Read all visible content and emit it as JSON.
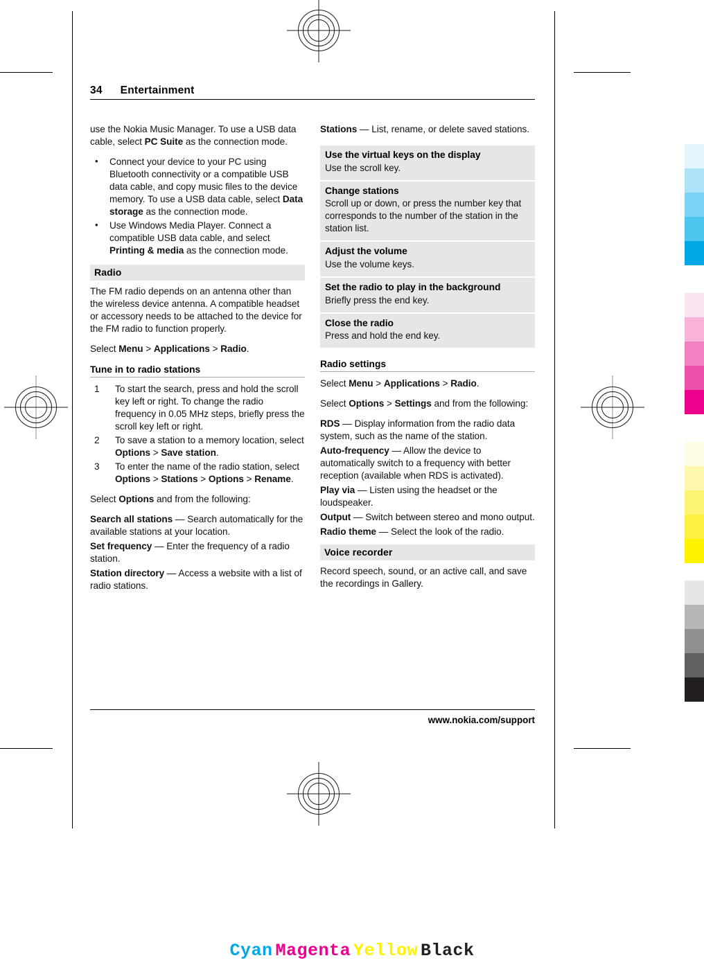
{
  "document": {
    "page_number": "34",
    "chapter": "Entertainment",
    "footer_url": "www.nokia.com/support"
  },
  "left_column": {
    "continued_paragraph": {
      "text_1": "use the Nokia Music Manager. To use a USB data cable, select ",
      "bold_1": "PC Suite",
      "text_2": " as the connection mode."
    },
    "bullets": [
      {
        "text_1": "Connect your device to your PC using Bluetooth connectivity or a compatible USB data cable, and copy music files to the device memory. To use a USB data cable, select ",
        "bold_1": "Data storage",
        "text_2": " as the connection mode."
      },
      {
        "text_1": "Use Windows Media Player. Connect a compatible USB data cable, and select ",
        "bold_1": "Printing & media",
        "text_2": " as the connection mode."
      }
    ],
    "radio_heading": "Radio",
    "radio_intro": "The FM radio depends on an antenna other than the wireless device antenna. A compatible headset or accessory needs to be attached to the device for the FM radio to function properly.",
    "radio_select": {
      "prefix": "Select ",
      "menu": "Menu",
      "sep1": " > ",
      "applications": "Applications",
      "sep2": " > ",
      "radio": "Radio",
      "suffix": "."
    },
    "tune_heading": "Tune in to radio stations",
    "steps": [
      {
        "text_1": "To start the search, press and hold the scroll key left or right. To change the radio frequency in 0.05 MHz steps, briefly press the scroll key left or right."
      },
      {
        "text_1": "To save a station to a memory location, select ",
        "bold_1": "Options",
        "text_2": " > ",
        "bold_2": "Save station",
        "text_3": "."
      },
      {
        "text_1": "To enter the name of the radio station, select ",
        "bold_1": "Options",
        "text_2": " > ",
        "bold_2": "Stations",
        "text_3": " > ",
        "bold_3": "Options",
        "text_4": " > ",
        "bold_4": "Rename",
        "text_5": "."
      }
    ],
    "options_intro": {
      "prefix": "Select ",
      "bold": "Options",
      "suffix": " and from the following:"
    },
    "option_items": [
      {
        "term": "Search all stations",
        "dash": "  — ",
        "desc": "Search automatically for the available stations at your location."
      },
      {
        "term": "Set frequency",
        "dash": "  — ",
        "desc": "Enter the frequency of a radio station."
      },
      {
        "term": "Station directory",
        "dash": "  — ",
        "desc": "Access a website with a list of radio stations."
      }
    ]
  },
  "right_column": {
    "option_items_continued": [
      {
        "term": "Stations",
        "dash": "  — ",
        "desc": "List, rename, or delete saved stations."
      }
    ],
    "keys_table": [
      {
        "title": "Use the virtual keys on the display",
        "body": "Use the scroll key."
      },
      {
        "title": "Change stations",
        "body": "Scroll up or down, or press the number key that corresponds to the number of the station in the station list."
      },
      {
        "title": "Adjust the volume",
        "body": "Use the volume keys."
      },
      {
        "title": "Set the radio to play in the background",
        "body": "Briefly press the end key."
      },
      {
        "title": "Close the radio",
        "body": "Press and hold the end key."
      }
    ],
    "settings_heading": "Radio settings",
    "settings_select_1": {
      "prefix": "Select ",
      "menu": "Menu",
      "sep1": " > ",
      "applications": "Applications",
      "sep2": " > ",
      "radio": "Radio",
      "suffix": "."
    },
    "settings_select_2": {
      "prefix": "Select ",
      "options": "Options",
      "sep1": " > ",
      "settings": "Settings",
      "suffix": " and from the following:"
    },
    "settings_items": [
      {
        "term": "RDS",
        "dash": " — ",
        "desc": "Display information from the radio data system, such as the name of the station."
      },
      {
        "term": "Auto-frequency",
        "dash": "  — ",
        "desc": "Allow the device to automatically switch to a frequency with better reception (available when RDS is activated)."
      },
      {
        "term": "Play via",
        "dash": "  — ",
        "desc": "Listen using the headset or the loudspeaker."
      },
      {
        "term": "Output",
        "dash": "  — ",
        "desc": "Switch between stereo and mono output."
      },
      {
        "term": "Radio theme",
        "dash": "  — ",
        "desc": "Select the look of the radio."
      }
    ],
    "voice_recorder_heading": "Voice recorder",
    "voice_recorder_body": "Record speech, sound, or an active call, and save the recordings in Gallery."
  },
  "press_marks": {
    "cmyk_legend": [
      {
        "label": "Cyan",
        "color": "#00a7e5"
      },
      {
        "label": "Magenta",
        "color": "#ec008c"
      },
      {
        "label": "Yellow",
        "color": "#fff200"
      },
      {
        "label": "Black",
        "color": "#231f20"
      }
    ],
    "calibration_bars": [
      {
        "name": "cyan-bar",
        "swatches": [
          "#e4f5fc",
          "#aee3f7",
          "#7ad3f3",
          "#4cc6ef",
          "#00a7e5"
        ]
      },
      {
        "name": "magenta-bar",
        "swatches": [
          "#fbe4f1",
          "#f7b3da",
          "#f281c2",
          "#ee4fab",
          "#ec008c"
        ]
      },
      {
        "name": "yellow-bar",
        "swatches": [
          "#fffce6",
          "#fdf8ae",
          "#fdf472",
          "#fdf040",
          "#fff200"
        ]
      },
      {
        "name": "gray-bar",
        "swatches": [
          "#e6e6e6",
          "#b7b7b7",
          "#909090",
          "#616161",
          "#231f20"
        ]
      }
    ]
  }
}
